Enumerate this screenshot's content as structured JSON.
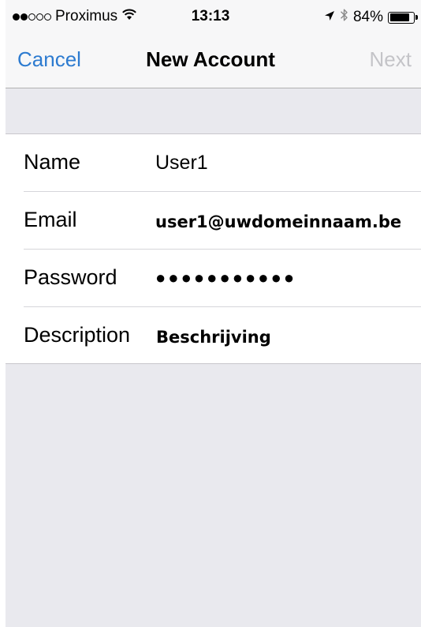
{
  "status_bar": {
    "signal_filled": 2,
    "signal_empty": 3,
    "carrier": "Proximus",
    "time": "13:13",
    "battery_percent": "84%",
    "battery_level": 0.84,
    "icons": [
      "wifi-icon",
      "location-arrow-icon",
      "bluetooth-icon",
      "battery-icon"
    ]
  },
  "nav": {
    "cancel_label": "Cancel",
    "title": "New Account",
    "next_label": "Next"
  },
  "form": {
    "rows": [
      {
        "label": "Name",
        "value": "User1"
      },
      {
        "label": "Email",
        "value": "user1@uwdomeinnaam.be"
      },
      {
        "label": "Password",
        "value": "●●●●●●●●●●●"
      },
      {
        "label": "Description",
        "value": "Beschrijving"
      }
    ]
  },
  "colors": {
    "accent": "#2d7bd0",
    "disabled": "#c4c4c8",
    "group_background": "#e9e9ee",
    "bar_background": "#f7f7f8"
  }
}
